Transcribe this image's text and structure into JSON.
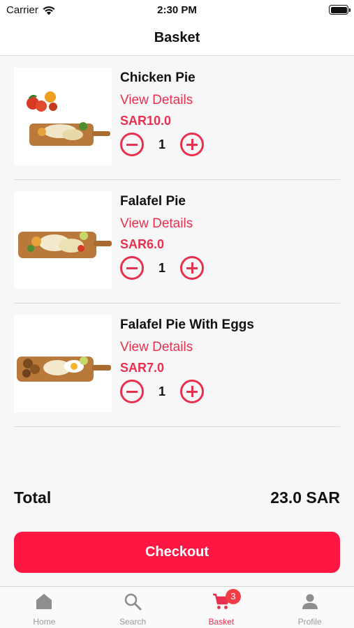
{
  "status_bar": {
    "carrier": "Carrier",
    "time": "2:30 PM"
  },
  "header": {
    "title": "Basket"
  },
  "items": [
    {
      "name": "Chicken Pie",
      "view_details": "View Details",
      "price": "SAR10.0",
      "quantity": "1"
    },
    {
      "name": "Falafel Pie",
      "view_details": "View Details",
      "price": "SAR6.0",
      "quantity": "1"
    },
    {
      "name": "Falafel Pie With Eggs",
      "view_details": "View Details",
      "price": "SAR7.0",
      "quantity": "1"
    }
  ],
  "summary": {
    "total_label": "Total",
    "total_amount": "23.0 SAR"
  },
  "checkout": {
    "label": "Checkout"
  },
  "tabs": [
    {
      "label": "Home",
      "icon": "home-icon"
    },
    {
      "label": "Search",
      "icon": "search-icon"
    },
    {
      "label": "Basket",
      "icon": "cart-icon",
      "badge": "3",
      "active": true
    },
    {
      "label": "Profile",
      "icon": "person-icon"
    }
  ],
  "colors": {
    "accent": "#e8304f",
    "checkout": "#ff1744",
    "badge": "#f23d47"
  }
}
